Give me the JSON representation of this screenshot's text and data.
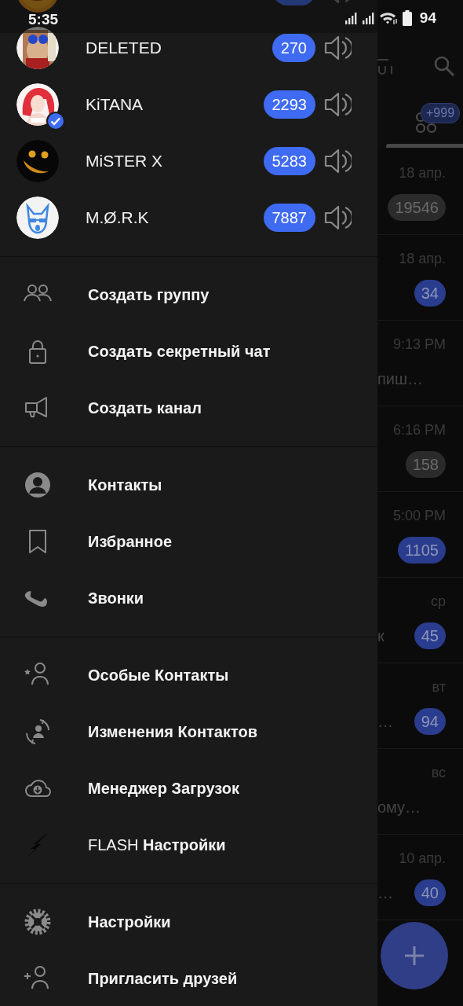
{
  "status_bar": {
    "time": "5:35",
    "battery": "94"
  },
  "accounts": [
    {
      "kind": "partial"
    },
    {
      "kind": "account",
      "name": "DELETED",
      "count": "270",
      "verified": false
    },
    {
      "kind": "account",
      "name": "KiTANA",
      "count": "2293",
      "verified": true
    },
    {
      "kind": "account",
      "name": "MiSTER X",
      "count": "5283",
      "verified": false
    },
    {
      "kind": "account",
      "name": "M.Ø.R.K",
      "count": "7887",
      "verified": false
    }
  ],
  "menu_sections": [
    [
      {
        "kind": "bold",
        "label": "Создать группу"
      },
      {
        "kind": "bold",
        "label": "Создать секретный чат"
      },
      {
        "kind": "bold",
        "label": "Создать канал"
      }
    ],
    [
      {
        "kind": "bold",
        "label": "Контакты"
      },
      {
        "kind": "bold",
        "label": "Избранное"
      },
      {
        "kind": "bold",
        "label": "Звонки"
      }
    ],
    [
      {
        "kind": "bold",
        "label": "Особые Контакты"
      },
      {
        "kind": "bold",
        "label": "Изменения Контактов"
      },
      {
        "kind": "bold",
        "label": "Менеджер Загрузок"
      },
      {
        "kind": "mixed",
        "label": "FLASH **Настройки**"
      }
    ],
    [
      {
        "kind": "bold",
        "label": "Настройки"
      },
      {
        "kind": "bold",
        "label": "Пригласить друзей"
      }
    ]
  ],
  "chat_list": {
    "tab_badge": "+999",
    "chats": [
      {
        "time": "18 апр.",
        "count": "19546",
        "muted": true
      },
      {
        "time": "18 апр.",
        "count": "34",
        "muted": false
      },
      {
        "time": "9:13 PM",
        "preview": "пиш…"
      },
      {
        "time": "6:16 PM",
        "count": "158",
        "muted": true
      },
      {
        "time": "5:00 PM",
        "count": "1105",
        "muted": false
      },
      {
        "time": "ср",
        "preview": "к",
        "count": "45",
        "muted": false
      },
      {
        "time": "вт",
        "preview": "…",
        "count": "94",
        "muted": false
      },
      {
        "time": "вс",
        "preview": "ому…"
      },
      {
        "time": "10 апр.",
        "preview": "…",
        "count": "40",
        "muted": false
      }
    ]
  }
}
